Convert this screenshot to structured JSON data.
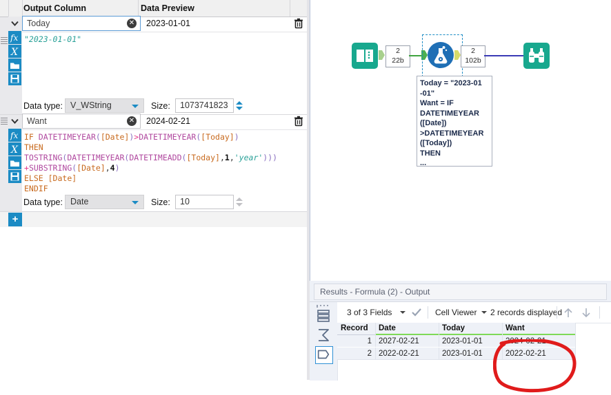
{
  "config_panel": {
    "headers": {
      "output_column": "Output Column",
      "data_preview": "Data Preview"
    },
    "fields": [
      {
        "name": "Today",
        "preview": "2023-01-01",
        "expression_lines": [
          [
            {
              "t": "\"2023-01-01\"",
              "c": "str"
            }
          ]
        ],
        "data_type_label": "Data type:",
        "data_type": "V_WString",
        "size_label": "Size:",
        "size": "1073741823"
      },
      {
        "name": "Want",
        "preview": "2024-02-21",
        "expression_lines": [
          [
            {
              "t": "IF ",
              "c": "if"
            },
            {
              "t": "DATETIMEYEAR",
              "c": "fn"
            },
            {
              "t": "(",
              "c": "paren"
            },
            {
              "t": "[Date]",
              "c": "field"
            },
            {
              "t": ")",
              "c": "paren"
            },
            {
              "t": ">",
              "c": "op"
            },
            {
              "t": "DATETIMEYEAR",
              "c": "fn"
            },
            {
              "t": "(",
              "c": "paren"
            },
            {
              "t": "[Today]",
              "c": "field"
            },
            {
              "t": ")",
              "c": "paren"
            }
          ],
          [
            {
              "t": "THEN",
              "c": "if"
            }
          ],
          [
            {
              "t": "TOSTRING",
              "c": "fn"
            },
            {
              "t": "(",
              "c": "paren"
            },
            {
              "t": "DATETIMEYEAR",
              "c": "fn"
            },
            {
              "t": "(",
              "c": "paren"
            },
            {
              "t": "DATETIMEADD",
              "c": "fn"
            },
            {
              "t": "(",
              "c": "paren"
            },
            {
              "t": "[Today]",
              "c": "field"
            },
            {
              "t": ",",
              "c": "plain"
            },
            {
              "t": "1",
              "c": "num"
            },
            {
              "t": ",",
              "c": "plain"
            },
            {
              "t": "'year'",
              "c": "str"
            },
            {
              "t": ")))",
              "c": "paren"
            }
          ],
          [
            {
              "t": "+",
              "c": "op"
            },
            {
              "t": "SUBSTRING",
              "c": "fn"
            },
            {
              "t": "(",
              "c": "paren"
            },
            {
              "t": "[Date]",
              "c": "field"
            },
            {
              "t": ",",
              "c": "plain"
            },
            {
              "t": "4",
              "c": "num"
            },
            {
              "t": ")",
              "c": "paren"
            }
          ],
          [
            {
              "t": "ELSE ",
              "c": "if"
            },
            {
              "t": "[Date]",
              "c": "field"
            }
          ],
          [
            {
              "t": "ENDIF",
              "c": "if"
            }
          ]
        ],
        "data_type_label": "Data type:",
        "data_type": "Date",
        "size_label": "Size:",
        "size": "10"
      }
    ],
    "tool_buttons": [
      "fx-icon",
      "variable-x-icon",
      "open-folder-icon",
      "save-disk-icon"
    ],
    "add_button_label": "+"
  },
  "canvas": {
    "nodes": [
      {
        "icon": "book-input-data-icon",
        "color": "#18a88e"
      },
      {
        "icon": "formula-flask-icon",
        "color": "#1f6fb5",
        "selected": true
      },
      {
        "icon": "browse-binoculars-icon",
        "color": "#18a88e"
      }
    ],
    "connections": [
      {
        "records": "2",
        "size": "22b"
      },
      {
        "records": "2",
        "size": "102b"
      }
    ],
    "tooltip_lines": [
      "Today = \"2023-01",
      "-01\"",
      "Want = IF",
      "DATETIMEYEAR",
      "([Date])",
      ">DATETIMEYEAR",
      "([Today])",
      "THEN",
      "..."
    ]
  },
  "results": {
    "title": "Results - Formula (2) - Output",
    "toolbar": {
      "fields_label": "3 of 3 Fields",
      "viewer_label": "Cell Viewer",
      "records_label": "2 records displayed"
    },
    "side_icons": [
      "table-rows-icon",
      "sum-sigma-icon",
      "field-shape-icon"
    ],
    "columns": [
      "Record",
      "Date",
      "Today",
      "Want"
    ],
    "rows": [
      {
        "record": "1",
        "date": "2027-02-21",
        "today": "2023-01-01",
        "want": "2024-02-21"
      },
      {
        "record": "2",
        "date": "2022-02-21",
        "today": "2023-01-01",
        "want": "2022-02-21"
      }
    ],
    "annotation": {
      "shape": "red-ellipse-highlight",
      "color": "#e01b1b"
    }
  }
}
